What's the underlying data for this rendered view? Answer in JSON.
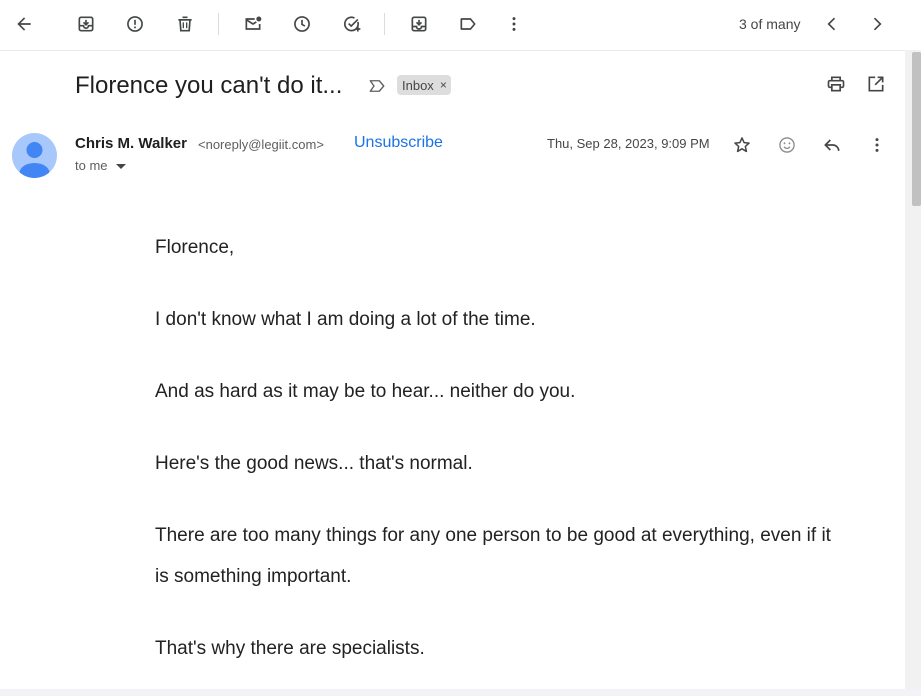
{
  "toolbar": {
    "icons": [
      "back-arrow-icon",
      "archive-icon",
      "report-spam-icon",
      "delete-icon",
      "mark-unread-icon",
      "snooze-icon",
      "add-to-tasks-icon",
      "move-to-icon",
      "label-icon",
      "more-vert-icon"
    ],
    "pager": "3 of many"
  },
  "email": {
    "subject": "Florence you can't do it...",
    "label": "Inbox",
    "label_close": "×",
    "sender_name": "Chris M. Walker",
    "sender_email": "<noreply@legiit.com>",
    "unsubscribe": "Unsubscribe",
    "recipient": "to me",
    "date": "Thu, Sep 28, 2023, 9:09 PM",
    "body": [
      "Florence,",
      "I don't know what I am doing a lot of the time.",
      "And as hard as it may be to hear... neither do you.",
      "Here's the good news... that's normal.",
      "There are too many things for any one person to be good at everything, even if it is something important.",
      "That's why there are specialists."
    ]
  },
  "colors": {
    "link": "#1a73e8",
    "avatar_bg": "#a8c7fa",
    "avatar_fg": "#4285f4",
    "label_chip": "#dddddd"
  }
}
